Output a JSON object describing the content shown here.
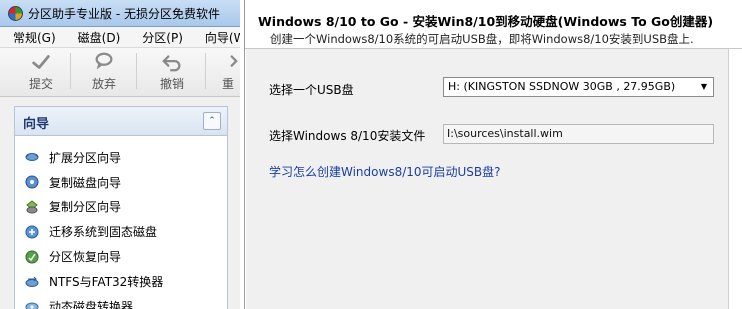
{
  "left_window": {
    "title": "分区助手专业版 - 无损分区免费软件",
    "menu": [
      "常规(G)",
      "磁盘(D)",
      "分区(P)",
      "向导(W)"
    ],
    "toolbar": [
      {
        "label": "提交",
        "icon": "check-icon"
      },
      {
        "label": "放弃",
        "icon": "discard-icon"
      },
      {
        "label": "撤销",
        "icon": "undo-icon"
      },
      {
        "label": "重",
        "icon": "redo-icon"
      }
    ],
    "panel": {
      "title": "向导",
      "collapse_glyph": "⌃",
      "items": [
        {
          "label": "扩展分区向导",
          "icon": "extend-partition-icon"
        },
        {
          "label": "复制磁盘向导",
          "icon": "copy-disk-icon"
        },
        {
          "label": "复制分区向导",
          "icon": "copy-partition-icon"
        },
        {
          "label": "迁移系统到固态磁盘",
          "icon": "migrate-ssd-icon"
        },
        {
          "label": "分区恢复向导",
          "icon": "partition-recovery-icon"
        },
        {
          "label": "NTFS与FAT32转换器",
          "icon": "ntfs-fat32-converter-icon"
        },
        {
          "label": "动态磁盘转换器",
          "icon": "dynamic-disk-converter-icon"
        }
      ]
    }
  },
  "right_window": {
    "title": "Windows 8/10 to Go - 安装Win8/10到移动硬盘(Windows To Go创建器)",
    "subtitle": "创建一个Windows8/10系统的可启动USB盘，即将Windows8/10安装到USB盘上.",
    "select_usb_label": "选择一个USB盘",
    "select_usb_value": "H: (KINGSTON SSDNOW 30GB    , 27.95GB)",
    "install_file_label": "选择Windows 8/10安装文件",
    "install_file_value": "I:\\sources\\install.wim",
    "help_link": "学习怎么创建Windows8/10可启动USB盘?"
  },
  "colors": {
    "title_gradient_top": "#c9def5",
    "panel_header_text": "#1e3a6e",
    "link": "#1a3ea6",
    "body_bg": "#f0f0f0"
  }
}
